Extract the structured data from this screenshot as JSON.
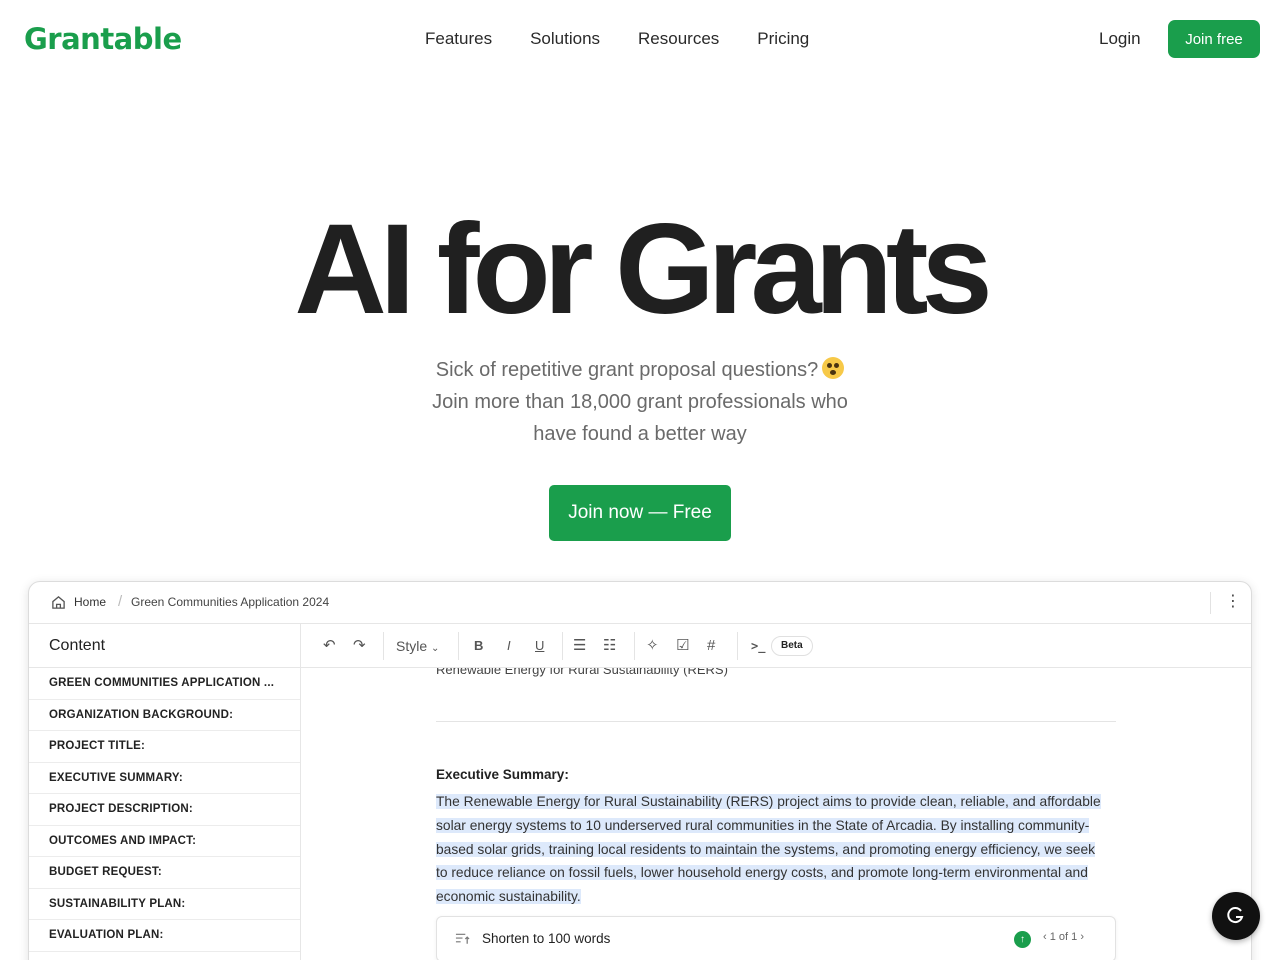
{
  "nav": {
    "logo": "Grantable",
    "links": [
      "Features",
      "Solutions",
      "Resources",
      "Pricing"
    ],
    "login": "Login",
    "join_free": "Join free"
  },
  "hero": {
    "title": "AI for Grants",
    "subtitle_line1": "Sick of repetitive grant proposal questions?",
    "subtitle_line2": "Join more than 18,000 grant professionals who",
    "subtitle_line3": "have found a better way",
    "cta": "Join now — Free"
  },
  "app": {
    "breadcrumb": {
      "home": "Home",
      "document": "Green Communities Application 2024"
    },
    "sidebar": {
      "title": "Content",
      "items": [
        "GREEN COMMUNITIES APPLICATION ...",
        "ORGANIZATION BACKGROUND:",
        "PROJECT TITLE:",
        "EXECUTIVE SUMMARY:",
        "PROJECT DESCRIPTION:",
        "OUTCOMES AND IMPACT:",
        "BUDGET REQUEST:",
        "SUSTAINABILITY PLAN:",
        "EVALUATION PLAN:"
      ]
    },
    "toolbar": {
      "style_label": "Style",
      "beta": "Beta"
    },
    "editor": {
      "cut_line": "Renewable Energy for Rural Sustainability (RERS)",
      "heading": "Executive Summary:",
      "paragraph": "The Renewable Energy for Rural Sustainability (RERS) project aims to provide clean, reliable, and affordable solar energy systems to 10 underserved rural communities in the State of Arcadia. By installing community-based solar grids, training local residents to maintain the systems, and promoting energy efficiency, we seek to reduce reliance on fossil fuels, lower household energy costs, and promote long-term environmental and economic sustainability.",
      "suggestion": "Shorten to 100 words",
      "pager": "1 of 1"
    }
  },
  "colors": {
    "brand_green": "#1a9e4c",
    "highlight": "#dde9fb"
  }
}
